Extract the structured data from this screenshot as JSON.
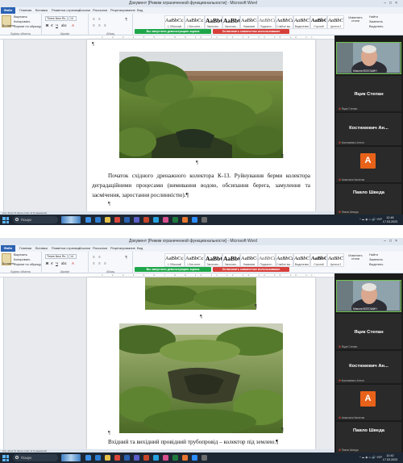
{
  "screens": [
    {
      "window_title": "Документ [Режим ограниченной функциональности] - Microsoft Word",
      "caption_text": "Початок східного дренажного колектора К-13. Руйнування берми колектора деградаційними процесами (вимивання водою, обсипання берега, замулення та засмічення, заростання рослинністю).¶",
      "clock_time": "12:45",
      "clock_date": "17.03.2023"
    },
    {
      "window_title": "Документ [Режим ограниченной функциональности] - Microsoft Word",
      "caption_text": "Вхідний та вихідний провідний трубопровід – колектор під землею.¶",
      "clock_time": "12:42",
      "clock_date": "17.03.2023"
    }
  ],
  "ribbon": {
    "file_tab": "Файл",
    "tabs": [
      "Главная",
      "Вставка",
      "Разметка страницы",
      "Ссылки",
      "Рассылки",
      "Рецензирование",
      "Вид"
    ],
    "paste_label": "Вставить",
    "cut_label": "Вырезать",
    "copy_label": "Копировать",
    "format_painter_label": "Формат по образцу",
    "clipboard_group": "Буфер обмена",
    "font_name": "Times New Ro",
    "font_size": "14",
    "font_group": "Шрифт",
    "paragraph_group": "Абзац",
    "styles_group": "Стили",
    "change_styles_label": "Изменить стили",
    "find_label": "Найти",
    "replace_label": "Заменить",
    "select_label": "Выделить",
    "editing_group": "Редактирование",
    "demo_banner": "Вы запустили демонстрацию экрана",
    "stop_banner": "Остановить совместное использование",
    "styles": [
      {
        "preview": "AaBbCcDd",
        "name": "1 Обычный"
      },
      {
        "preview": "AaBbCcDd",
        "name": "1 Без инте..."
      },
      {
        "preview": "AaBbC",
        "name": "Заголово..."
      },
      {
        "preview": "AaBbC",
        "name": "Заголово..."
      },
      {
        "preview": "AaBbCcDd",
        "name": "Название"
      },
      {
        "preview": "AaBbCcDd",
        "name": "Подзагол..."
      },
      {
        "preview": "AaBbCcDd",
        "name": "Слабое вы..."
      },
      {
        "preview": "AaBbCcDd",
        "name": "Выделение"
      },
      {
        "preview": "AaBbCcDd",
        "name": "Строгий"
      },
      {
        "preview": "AaBbCcDd",
        "name": "Цитата 2"
      }
    ]
  },
  "statusbar": "Стр: 43 из 72  Число слов: 11 8  украинский",
  "taskbar": {
    "search_placeholder": "Пошук",
    "lang": "УКР",
    "apps": [
      "explorer",
      "edge",
      "chrome",
      "folder",
      "word",
      "teams",
      "powerpoint",
      "telegram",
      "mail",
      "store",
      "firefox",
      "excel",
      "zoom"
    ]
  },
  "participants": {
    "camera_name": "Микола ВОЛОШИН",
    "tiles": [
      {
        "name": "Яцик Степан",
        "sub": "Яцик Степан"
      },
      {
        "name": "Костюкевич Ан...",
        "sub": "Костюкевич Антон"
      },
      {
        "name": "",
        "sub": "Анастасія Каличак",
        "avatar": "А"
      },
      {
        "name": "Павло Шведа",
        "sub": "Павло Шведа"
      }
    ]
  },
  "colors": {
    "word_blue": "#2b62b2",
    "banner_green": "#1ea64a",
    "banner_red": "#d7403a",
    "avatar_orange": "#e8621a",
    "camera_border": "#74c44e",
    "taskbar_bg": "#1d2733"
  }
}
